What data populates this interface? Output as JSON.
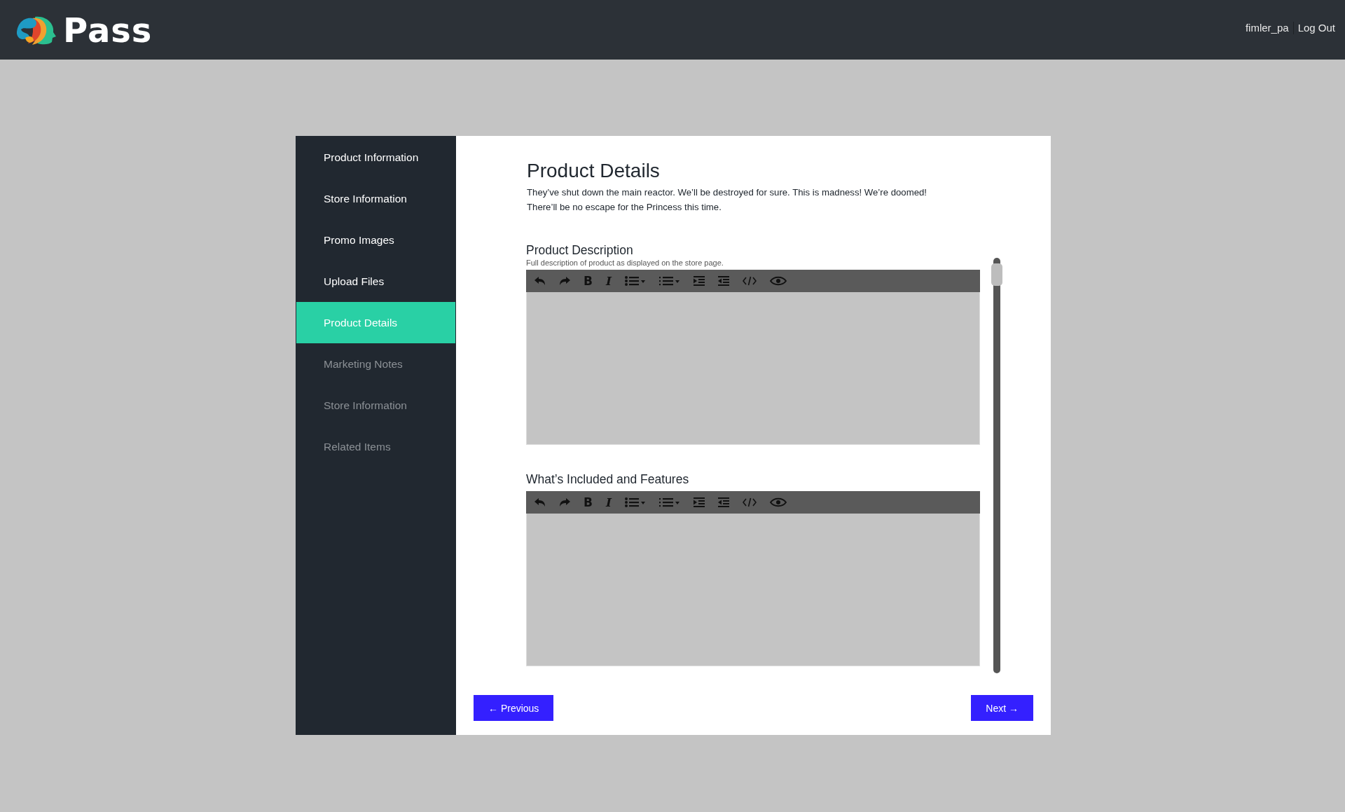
{
  "header": {
    "logo_text": "Pass",
    "username": "fimler_pa",
    "logout": "Log Out"
  },
  "sidebar": {
    "items": [
      {
        "label": "Product Information",
        "selected": false,
        "disabled": false
      },
      {
        "label": "Store Information",
        "selected": false,
        "disabled": false
      },
      {
        "label": "Promo Images",
        "selected": false,
        "disabled": false
      },
      {
        "label": "Upload Files",
        "selected": false,
        "disabled": false
      },
      {
        "label": "Product Details",
        "selected": true,
        "disabled": false
      },
      {
        "label": "Marketing Notes",
        "selected": false,
        "disabled": true
      },
      {
        "label": "Store Information",
        "selected": false,
        "disabled": true
      },
      {
        "label": "Related Items",
        "selected": false,
        "disabled": true
      }
    ]
  },
  "main": {
    "title": "Product Details",
    "description": [
      "They’ve shut down the main reactor. We’ll be destroyed for sure. This is madness! We’re doomed!",
      "There’ll be no escape for the Princess this time."
    ],
    "editors": [
      {
        "label": "Product Description",
        "hint": "Full description of product as displayed on the store page.",
        "toolbar": [
          {
            "kind": "undo"
          },
          {
            "kind": "redo"
          },
          {
            "kind": "bold",
            "glyph": "B"
          },
          {
            "kind": "italic",
            "glyph": "I"
          },
          {
            "kind": "bullets"
          },
          {
            "kind": "numbers"
          },
          {
            "kind": "indent"
          },
          {
            "kind": "outdent"
          },
          {
            "kind": "code"
          },
          {
            "kind": "preview"
          }
        ]
      },
      {
        "label": "What’s Included and Features",
        "toolbar": [
          {
            "kind": "undo"
          },
          {
            "kind": "redo"
          },
          {
            "kind": "bold",
            "glyph": "B"
          },
          {
            "kind": "italic",
            "glyph": "I"
          },
          {
            "kind": "bullets"
          },
          {
            "kind": "numbers"
          },
          {
            "kind": "indent"
          },
          {
            "kind": "outdent"
          },
          {
            "kind": "code"
          },
          {
            "kind": "preview"
          }
        ]
      }
    ],
    "buttons": {
      "previous": "← Previous",
      "next": "Next →"
    }
  }
}
